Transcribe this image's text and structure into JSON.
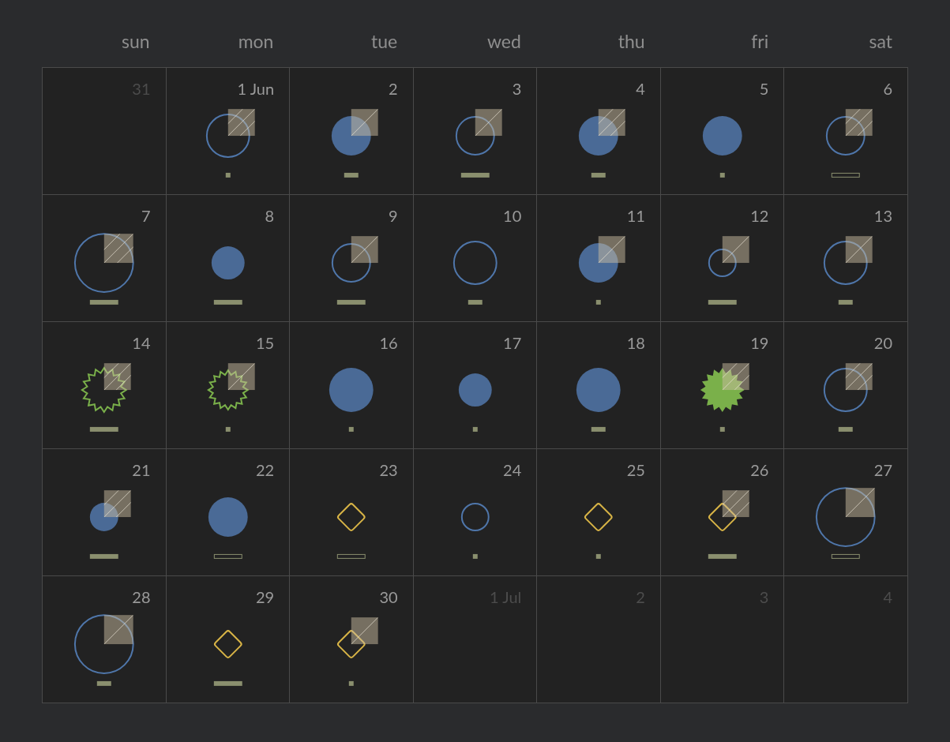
{
  "weekdays": [
    "sun",
    "mon",
    "tue",
    "wed",
    "thu",
    "fri",
    "sat"
  ],
  "days": [
    {
      "label": "31",
      "in_month": false
    },
    {
      "label": "1 Jun",
      "in_month": true,
      "marker": {
        "kind": "circle-l",
        "filled": false
      },
      "square": {
        "dense": true
      },
      "bar": {
        "kind": "short"
      }
    },
    {
      "label": "2",
      "in_month": true,
      "marker": {
        "kind": "circle-m",
        "filled": true
      },
      "square": {
        "dense": false
      },
      "bar": {
        "kind": "medium"
      }
    },
    {
      "label": "3",
      "in_month": true,
      "marker": {
        "kind": "circle-m",
        "filled": false
      },
      "square": {
        "dense": false
      },
      "bar": {
        "kind": "long"
      }
    },
    {
      "label": "4",
      "in_month": true,
      "marker": {
        "kind": "circle-m",
        "filled": true
      },
      "square": {
        "dense": true
      },
      "bar": {
        "kind": "medium"
      }
    },
    {
      "label": "5",
      "in_month": true,
      "marker": {
        "kind": "circle-m",
        "filled": true
      },
      "bar": {
        "kind": "short"
      }
    },
    {
      "label": "6",
      "in_month": true,
      "marker": {
        "kind": "circle-m",
        "filled": false
      },
      "square": {
        "dense": true
      },
      "bar": {
        "kind": "outline"
      }
    },
    {
      "label": "7",
      "in_month": true,
      "marker": {
        "kind": "circle-xl",
        "filled": false
      },
      "square": {
        "dense": true
      },
      "bar": {
        "kind": "long"
      }
    },
    {
      "label": "8",
      "in_month": true,
      "marker": {
        "kind": "circle-s",
        "filled": true
      },
      "bar": {
        "kind": "long"
      }
    },
    {
      "label": "9",
      "in_month": true,
      "marker": {
        "kind": "circle-m",
        "filled": false
      },
      "square": {
        "dense": false
      },
      "bar": {
        "kind": "long"
      }
    },
    {
      "label": "10",
      "in_month": true,
      "marker": {
        "kind": "circle-l",
        "filled": false
      },
      "bar": {
        "kind": "medium"
      }
    },
    {
      "label": "11",
      "in_month": true,
      "marker": {
        "kind": "circle-m",
        "filled": true
      },
      "square": {
        "dense": false
      },
      "bar": {
        "kind": "short"
      }
    },
    {
      "label": "12",
      "in_month": true,
      "marker": {
        "kind": "circle-xs",
        "filled": false
      },
      "square": {
        "dense": false
      },
      "bar": {
        "kind": "long"
      }
    },
    {
      "label": "13",
      "in_month": true,
      "marker": {
        "kind": "circle-l",
        "filled": false
      },
      "square": {
        "dense": false
      },
      "bar": {
        "kind": "medium"
      }
    },
    {
      "label": "14",
      "in_month": true,
      "marker": {
        "kind": "star-l",
        "filled": false
      },
      "square": {
        "dense": true
      },
      "bar": {
        "kind": "long"
      }
    },
    {
      "label": "15",
      "in_month": true,
      "marker": {
        "kind": "star-m",
        "filled": false
      },
      "square": {
        "dense": false
      },
      "bar": {
        "kind": "short"
      }
    },
    {
      "label": "16",
      "in_month": true,
      "marker": {
        "kind": "circle-l",
        "filled": true
      },
      "bar": {
        "kind": "short"
      }
    },
    {
      "label": "17",
      "in_month": true,
      "marker": {
        "kind": "circle-s",
        "filled": true
      },
      "bar": {
        "kind": "short"
      }
    },
    {
      "label": "18",
      "in_month": true,
      "marker": {
        "kind": "circle-l",
        "filled": true
      },
      "bar": {
        "kind": "medium"
      }
    },
    {
      "label": "19",
      "in_month": true,
      "marker": {
        "kind": "star-l",
        "filled": true
      },
      "square": {
        "dense": true
      },
      "bar": {
        "kind": "short"
      }
    },
    {
      "label": "20",
      "in_month": true,
      "marker": {
        "kind": "circle-l",
        "filled": false
      },
      "square": {
        "dense": true
      },
      "bar": {
        "kind": "medium"
      }
    },
    {
      "label": "21",
      "in_month": true,
      "marker": {
        "kind": "circle-xs",
        "filled": true
      },
      "square": {
        "dense": true
      },
      "bar": {
        "kind": "long"
      }
    },
    {
      "label": "22",
      "in_month": true,
      "marker": {
        "kind": "circle-m",
        "filled": true
      },
      "bar": {
        "kind": "outline"
      }
    },
    {
      "label": "23",
      "in_month": true,
      "marker": {
        "kind": "diamond",
        "filled": false
      },
      "bar": {
        "kind": "outline"
      }
    },
    {
      "label": "24",
      "in_month": true,
      "marker": {
        "kind": "circle-xs",
        "filled": false
      },
      "bar": {
        "kind": "short"
      }
    },
    {
      "label": "25",
      "in_month": true,
      "marker": {
        "kind": "diamond",
        "filled": false
      },
      "bar": {
        "kind": "short"
      }
    },
    {
      "label": "26",
      "in_month": true,
      "marker": {
        "kind": "diamond",
        "filled": false
      },
      "square": {
        "dense": true
      },
      "bar": {
        "kind": "long"
      }
    },
    {
      "label": "27",
      "in_month": true,
      "marker": {
        "kind": "circle-xl",
        "filled": false
      },
      "square": {
        "dense": false
      },
      "bar": {
        "kind": "outline"
      }
    },
    {
      "label": "28",
      "in_month": true,
      "marker": {
        "kind": "circle-xl",
        "filled": false
      },
      "square": {
        "dense": false
      },
      "bar": {
        "kind": "medium"
      }
    },
    {
      "label": "29",
      "in_month": true,
      "marker": {
        "kind": "diamond",
        "filled": false
      },
      "bar": {
        "kind": "long"
      }
    },
    {
      "label": "30",
      "in_month": true,
      "marker": {
        "kind": "diamond",
        "filled": false
      },
      "square": {
        "dense": false
      },
      "bar": {
        "kind": "short"
      }
    },
    {
      "label": "1 Jul",
      "in_month": false
    },
    {
      "label": "2",
      "in_month": false
    },
    {
      "label": "3",
      "in_month": false
    },
    {
      "label": "4",
      "in_month": false
    }
  ]
}
